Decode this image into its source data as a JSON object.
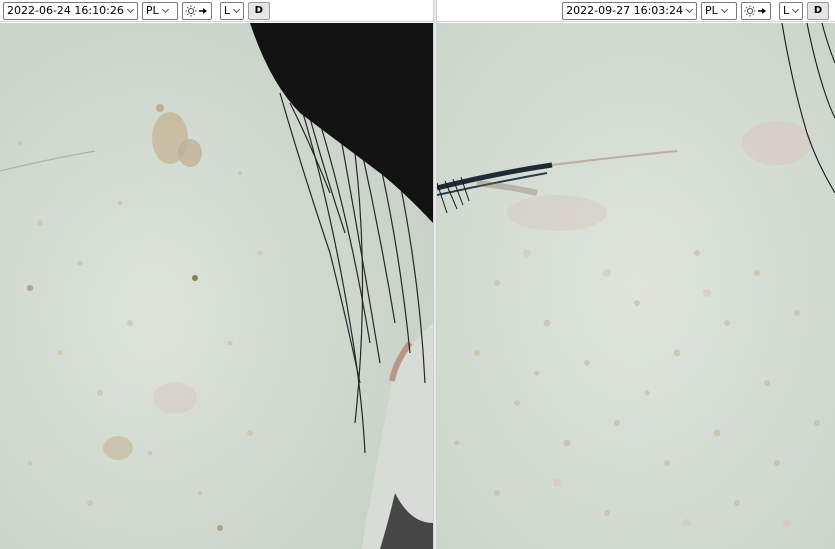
{
  "left_panel": {
    "datetime": "2022-06-24 16:10:26",
    "mode": "PL",
    "side": "L",
    "d_button": "D",
    "light_icon": "sun-arrow-icon"
  },
  "right_panel": {
    "datetime": "2022-09-27 16:03:24",
    "mode": "PL",
    "side": "L",
    "d_button": "D",
    "light_icon": "sun-arrow-icon"
  },
  "colors": {
    "skin_base": "#cdd6cc",
    "skin_light": "#dde3da",
    "spot": "#b8a98e",
    "hair": "#141414"
  }
}
